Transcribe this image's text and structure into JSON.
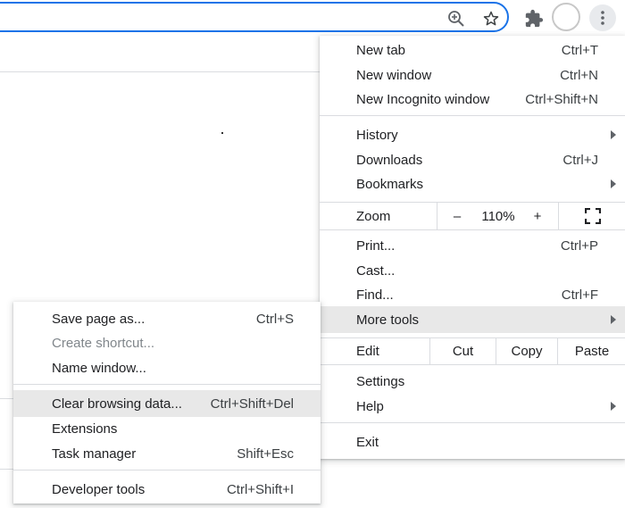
{
  "main_menu": {
    "new_tab": {
      "label": "New tab",
      "shortcut": "Ctrl+T"
    },
    "new_window": {
      "label": "New window",
      "shortcut": "Ctrl+N"
    },
    "new_incognito": {
      "label": "New Incognito window",
      "shortcut": "Ctrl+Shift+N"
    },
    "history": {
      "label": "History"
    },
    "downloads": {
      "label": "Downloads",
      "shortcut": "Ctrl+J"
    },
    "bookmarks": {
      "label": "Bookmarks"
    },
    "zoom": {
      "label": "Zoom",
      "minus": "–",
      "value": "110%",
      "plus": "+"
    },
    "print": {
      "label": "Print...",
      "shortcut": "Ctrl+P"
    },
    "cast": {
      "label": "Cast..."
    },
    "find": {
      "label": "Find...",
      "shortcut": "Ctrl+F"
    },
    "more_tools": {
      "label": "More tools"
    },
    "edit": {
      "label": "Edit",
      "cut": "Cut",
      "copy": "Copy",
      "paste": "Paste"
    },
    "settings": {
      "label": "Settings"
    },
    "help": {
      "label": "Help"
    },
    "exit": {
      "label": "Exit"
    }
  },
  "more_tools_menu": {
    "save_page": {
      "label": "Save page as...",
      "shortcut": "Ctrl+S"
    },
    "create_shortcut": {
      "label": "Create shortcut..."
    },
    "name_window": {
      "label": "Name window..."
    },
    "clear_browsing": {
      "label": "Clear browsing data...",
      "shortcut": "Ctrl+Shift+Del"
    },
    "extensions": {
      "label": "Extensions"
    },
    "task_manager": {
      "label": "Task manager",
      "shortcut": "Shift+Esc"
    },
    "developer_tools": {
      "label": "Developer tools",
      "shortcut": "Ctrl+Shift+I"
    }
  },
  "toolbar": {
    "icons": [
      "zoom-icon",
      "bookmark-star-icon",
      "extensions-puzzle-icon",
      "profile-avatar",
      "kebab-menu-icon"
    ]
  },
  "colors": {
    "omnibox_focus": "#1a73e8",
    "highlight": "#e8e8e8",
    "separator": "#dadce0"
  }
}
